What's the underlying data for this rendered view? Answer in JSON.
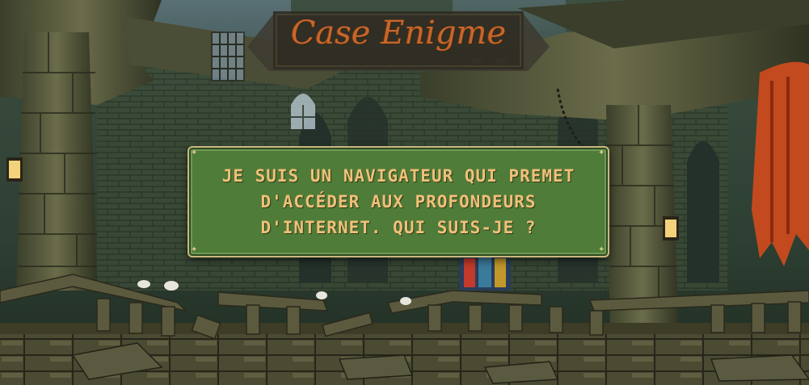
{
  "title": "Case Enigme",
  "riddle": {
    "lines": [
      "JE SUIS UN NAVIGATEUR QUI PREMET",
      "D'ACCÉDER AUX PROFONDEURS",
      "D'INTERNET. QUI SUIS-JE ?"
    ]
  },
  "colors": {
    "title": "#c8652c",
    "panel": "#4f7c38",
    "riddle_text": "#f0c07a"
  }
}
